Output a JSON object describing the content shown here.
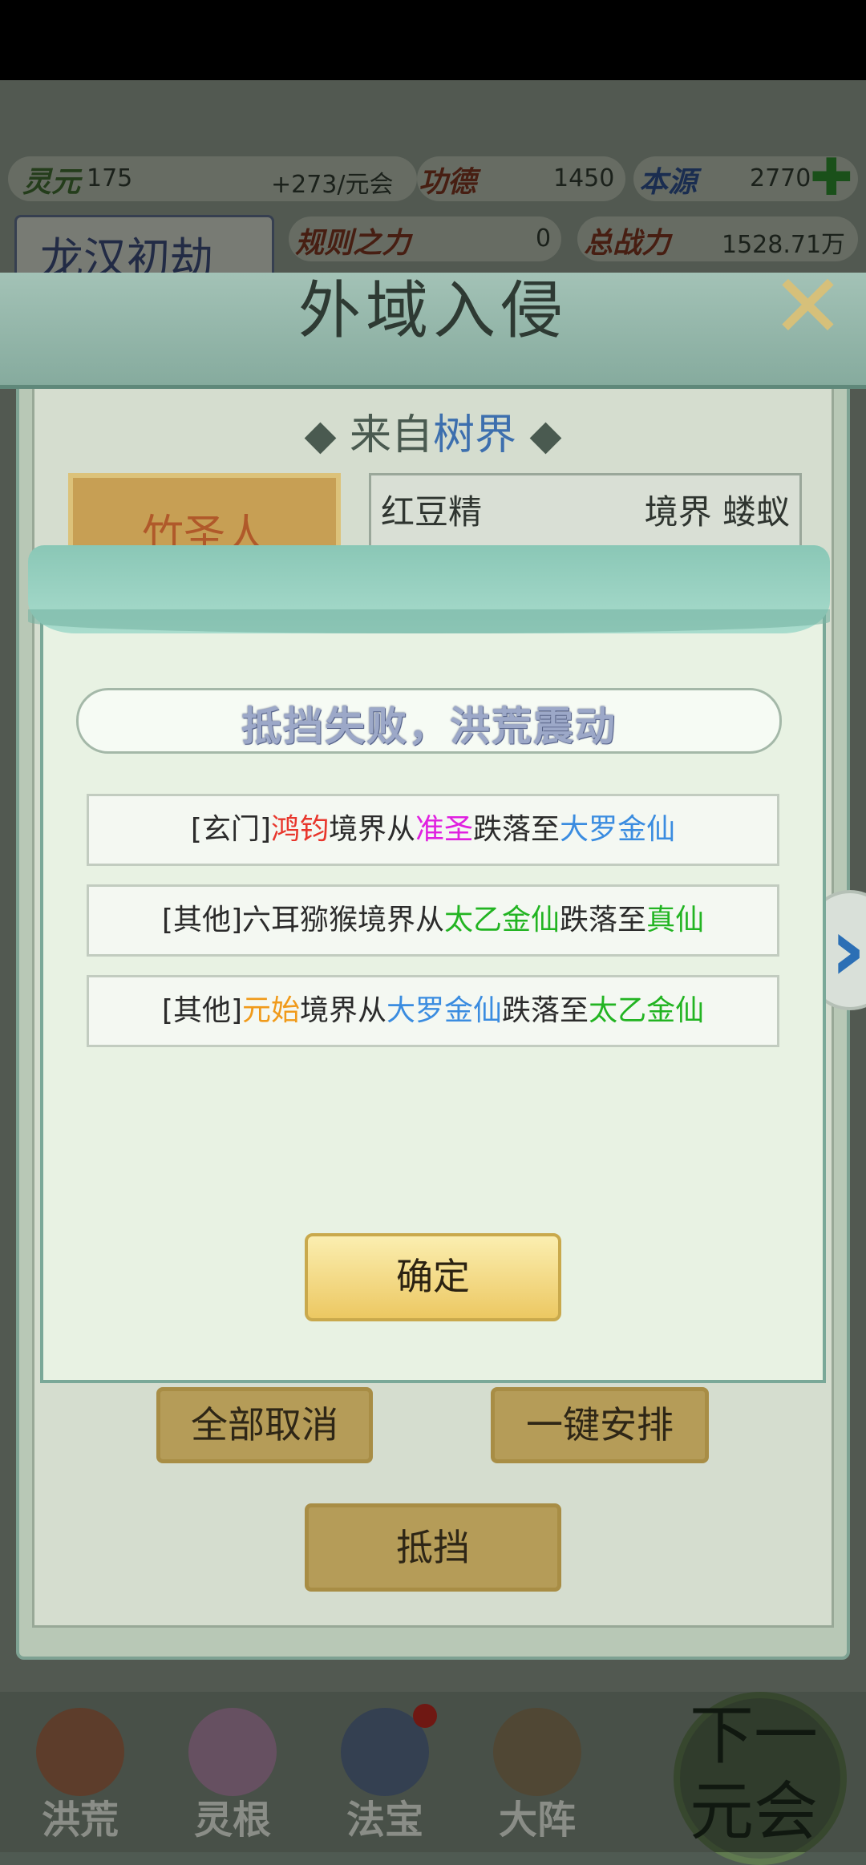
{
  "resources": {
    "lingyuan_label": "灵元",
    "lingyuan_value": "175",
    "lingyuan_rate": "+273/元会",
    "gongde_label": "功德",
    "gongde_value": "1450",
    "benyuan_label": "本源",
    "benyuan_value": "2770",
    "add_icon": "plus-icon"
  },
  "era": {
    "title": "龙汉初劫",
    "rule_power_label": "规则之力",
    "rule_power_value": "0",
    "total_power_label": "总战力",
    "total_power_value": "1528.71万"
  },
  "invasion_panel": {
    "title": "外域入侵",
    "from_prefix": "来自",
    "from_world": "树界",
    "defender_name": "竹圣人",
    "enemy_name": "红豆精",
    "enemy_realm": "境界 蝼蚁",
    "cancel_all_label": "全部取消",
    "auto_arrange_label": "一键安排",
    "resist_label": "抵挡"
  },
  "result_dialog": {
    "banner": "抵挡失败，洪荒震动",
    "entries": [
      {
        "tag": "[玄门]",
        "name": "鸿钧",
        "mid": "境界从",
        "from": "准圣",
        "mid2": "跌落至",
        "to": "大罗金仙"
      },
      {
        "tag": "[其他]",
        "name": "六耳猕猴",
        "mid": "境界从",
        "from": "太乙金仙",
        "mid2": "跌落至",
        "to": "真仙"
      },
      {
        "tag": "[其他]",
        "name": "元始",
        "mid": "境界从",
        "from": "大罗金仙",
        "mid2": "跌落至",
        "to": "太乙金仙"
      }
    ],
    "confirm_label": "确定"
  },
  "bottom_nav": {
    "items": [
      "洪荒",
      "灵根",
      "法宝",
      "大阵"
    ],
    "next_line1": "下一",
    "next_line2": "元会"
  },
  "colors": {
    "realm_red": "#e8362c",
    "realm_magenta": "#e020e0",
    "realm_blue": "#3a8ce0",
    "realm_green": "#22b422",
    "name_orange": "#f09a1a"
  }
}
